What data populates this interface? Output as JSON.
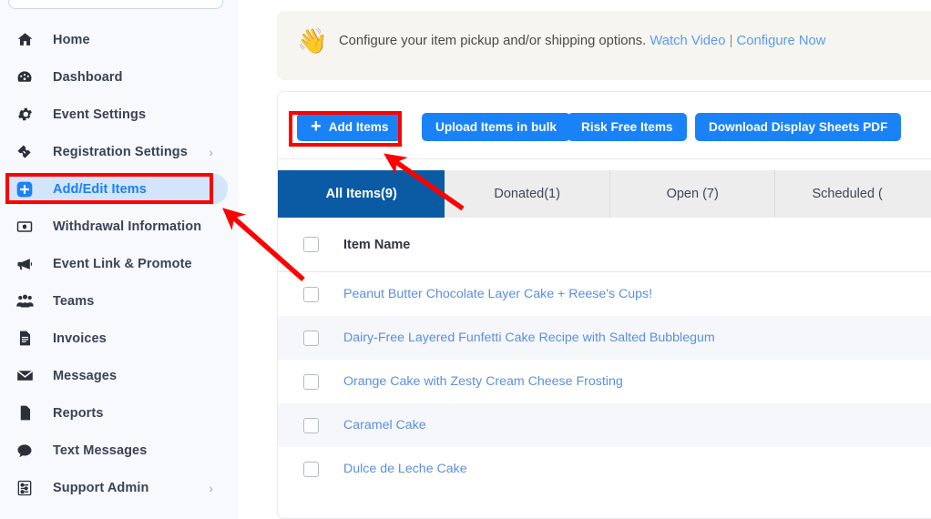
{
  "sidebar": {
    "profile": {
      "avatar_icon": "user-avatar-circle"
    },
    "items": [
      {
        "label": "Home",
        "icon": "home-icon",
        "active": false,
        "chevron": false
      },
      {
        "label": "Dashboard",
        "icon": "dashboard-gauge-icon",
        "active": false,
        "chevron": false
      },
      {
        "label": "Event Settings",
        "icon": "gear-icon",
        "active": false,
        "chevron": false
      },
      {
        "label": "Registration Settings",
        "icon": "ticket-icon",
        "active": false,
        "chevron": true
      },
      {
        "label": "Add/Edit Items",
        "icon": "plus-square-icon",
        "active": true,
        "chevron": false
      },
      {
        "label": "Withdrawal Information",
        "icon": "banknote-icon",
        "active": false,
        "chevron": false
      },
      {
        "label": "Event Link & Promote",
        "icon": "megaphone-icon",
        "active": false,
        "chevron": false
      },
      {
        "label": "Teams",
        "icon": "people-group-icon",
        "active": false,
        "chevron": false
      },
      {
        "label": "Invoices",
        "icon": "invoice-document-icon",
        "active": false,
        "chevron": false
      },
      {
        "label": "Messages",
        "icon": "envelope-icon",
        "active": false,
        "chevron": false
      },
      {
        "label": "Reports",
        "icon": "page-icon",
        "active": false,
        "chevron": false
      },
      {
        "label": "Text Messages",
        "icon": "chat-bubble-icon",
        "active": false,
        "chevron": false
      },
      {
        "label": "Support Admin",
        "icon": "sliders-list-icon",
        "active": false,
        "chevron": true
      }
    ]
  },
  "banner": {
    "hand_icon": "waving-hand-icon",
    "message": "Configure your item pickup and/or shipping options.",
    "watch_video_label": "Watch Video",
    "separator": "|",
    "configure_now_label": "Configure Now"
  },
  "toolbar": {
    "add_items_label": "Add Items",
    "add_items_plus": "+",
    "upload_bulk_label": "Upload Items in bulk",
    "risk_free_label": "Risk Free Items",
    "download_pdf_label": "Download Display Sheets PDF"
  },
  "tabs": [
    {
      "label": "All Items(9)",
      "active": true
    },
    {
      "label": "Donated(1)",
      "active": false
    },
    {
      "label": "Open (7)",
      "active": false
    },
    {
      "label": "Scheduled (",
      "active": false
    }
  ],
  "table": {
    "header": {
      "item_name": "Item Name"
    },
    "rows": [
      {
        "name": "Peanut Butter Chocolate Layer Cake + Reese's Cups!"
      },
      {
        "name": "Dairy-Free Layered Funfetti Cake Recipe with Salted Bubblegum"
      },
      {
        "name": "Orange Cake with Zesty Cream Cheese Frosting"
      },
      {
        "name": "Caramel Cake"
      },
      {
        "name": "Dulce de Leche Cake"
      }
    ]
  },
  "annotations": {
    "highlight_sidebar_item": "Add/Edit Items",
    "highlight_button": "Add Items",
    "arrow_count": 2,
    "color": "#ff0000"
  },
  "colors": {
    "accent_blue": "#1a82f7",
    "tab_active_blue": "#0a5ba4",
    "sidebar_bg": "#f7f9fc",
    "banner_bg": "#f6f5f0",
    "link_blue": "#5b8fe0",
    "annotation_red": "#ff0000"
  }
}
